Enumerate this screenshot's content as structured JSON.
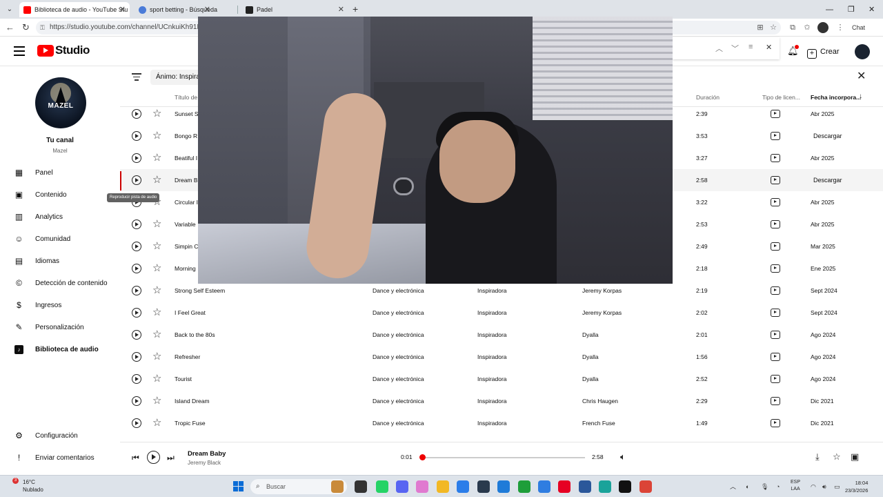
{
  "browser": {
    "tabs": [
      {
        "title": "Biblioteca de audio - YouTube Stu",
        "active": true,
        "favicon_color": "#ff0000"
      },
      {
        "title": "sport betting - Búsqueda",
        "active": false,
        "favicon_color": "#4a7bd8"
      },
      {
        "title": "Padel",
        "active": false,
        "favicon_color": "#222222"
      }
    ],
    "url": "https://studio.youtube.com/channel/UCnkuiKh91NC",
    "chat_label": "Chat"
  },
  "header": {
    "logo_text": "Studio",
    "create_label": "Crear"
  },
  "sidebar": {
    "channel_brand": "MAZEL",
    "channel_title": "Tu canal",
    "channel_name": "Mazel",
    "items": [
      {
        "label": "Panel",
        "icon": "dashboard-icon",
        "glyph": "▦"
      },
      {
        "label": "Contenido",
        "icon": "content-icon",
        "glyph": "▣"
      },
      {
        "label": "Analytics",
        "icon": "analytics-icon",
        "glyph": "▥"
      },
      {
        "label": "Comunidad",
        "icon": "community-icon",
        "glyph": "☺"
      },
      {
        "label": "Idiomas",
        "icon": "languages-icon",
        "glyph": "▤"
      },
      {
        "label": "Detección de contenido",
        "icon": "copyright-icon",
        "glyph": "©"
      },
      {
        "label": "Ingresos",
        "icon": "earn-icon",
        "glyph": "$"
      },
      {
        "label": "Personalización",
        "icon": "customization-icon",
        "glyph": "✎"
      },
      {
        "label": "Biblioteca de audio",
        "icon": "audio-library-icon",
        "glyph": "♪",
        "active": true
      }
    ],
    "footer": [
      {
        "label": "Configuración",
        "icon": "settings-icon",
        "glyph": "⚙"
      },
      {
        "label": "Enviar comentarios",
        "icon": "feedback-icon",
        "glyph": "!"
      }
    ]
  },
  "filter": {
    "chip": "Ánimo: Inspira"
  },
  "table": {
    "headers": {
      "title": "Título de",
      "duration": "Duración",
      "license": "Tipo de licen...",
      "date": "Fecha incorpora..."
    },
    "rows": [
      {
        "title": "Sunset S",
        "genre": "",
        "mood": "",
        "artist": "",
        "duration": "2:39",
        "date": "Abr 2025"
      },
      {
        "title": "Bongo R",
        "genre": "",
        "mood": "",
        "artist": "",
        "duration": "3:53",
        "download": "Descargar"
      },
      {
        "title": "Beatiful I",
        "genre": "",
        "mood": "",
        "artist": "",
        "duration": "3:27",
        "date": "Abr 2025"
      },
      {
        "title": "Dream B",
        "genre": "",
        "mood": "",
        "artist": "",
        "duration": "2:58",
        "download": "Descargar",
        "highlight": true
      },
      {
        "title": "Circular I",
        "genre": "",
        "mood": "",
        "artist": "",
        "duration": "3:22",
        "date": "Abr 2025"
      },
      {
        "title": "Variable",
        "genre": "",
        "mood": "",
        "artist": "",
        "duration": "2:53",
        "date": "Abr 2025"
      },
      {
        "title": "Simpin C",
        "genre": "",
        "mood": "",
        "artist": "",
        "duration": "2:49",
        "date": "Mar 2025"
      },
      {
        "title": "Morning",
        "genre": "",
        "mood": "",
        "artist": "",
        "duration": "2:18",
        "date": "Ene 2025"
      },
      {
        "title": "Strong Self Esteem",
        "genre": "Dance y electrónica",
        "mood": "Inspiradora",
        "artist": "Jeremy Korpas",
        "duration": "2:19",
        "date": "Sept 2024"
      },
      {
        "title": "I Feel Great",
        "genre": "Dance y electrónica",
        "mood": "Inspiradora",
        "artist": "Jeremy Korpas",
        "duration": "2:02",
        "date": "Sept 2024"
      },
      {
        "title": "Back to the 80s",
        "genre": "Dance y electrónica",
        "mood": "Inspiradora",
        "artist": "Dyalla",
        "duration": "2:01",
        "date": "Ago 2024"
      },
      {
        "title": "Refresher",
        "genre": "Dance y electrónica",
        "mood": "Inspiradora",
        "artist": "Dyalla",
        "duration": "1:56",
        "date": "Ago 2024"
      },
      {
        "title": "Tourist",
        "genre": "Dance y electrónica",
        "mood": "Inspiradora",
        "artist": "Dyalla",
        "duration": "2:52",
        "date": "Ago 2024"
      },
      {
        "title": "Island Dream",
        "genre": "Dance y electrónica",
        "mood": "Inspiradora",
        "artist": "Chris Haugen",
        "duration": "2:29",
        "date": "Dic 2021"
      },
      {
        "title": "Tropic Fuse",
        "genre": "Dance y electrónica",
        "mood": "Inspiradora",
        "artist": "French Fuse",
        "duration": "1:49",
        "date": "Dic 2021"
      }
    ],
    "tooltip": "Reproducir pista de audio"
  },
  "player": {
    "title": "Dream Baby",
    "artist": "Jeremy Black",
    "current": "0:01",
    "duration": "2:58",
    "progress_fraction": 0.006
  },
  "taskbar": {
    "weather_badge": "3",
    "temperature": "16°C",
    "condition": "Nublado",
    "search_placeholder": "Buscar",
    "lang_top": "ESP",
    "lang_bottom": "LAA",
    "time": "18:04",
    "date": "23/3/2026",
    "app_icons": [
      {
        "name": "widgets-icon",
        "color": "#c98a3a"
      },
      {
        "name": "file-explorer-icon",
        "color": "#333333"
      },
      {
        "name": "whatsapp-icon",
        "color": "#25d366"
      },
      {
        "name": "discord-icon",
        "color": "#5865f2"
      },
      {
        "name": "copilot-icon",
        "color": "#e07ad0"
      },
      {
        "name": "folder-icon",
        "color": "#f2b824"
      },
      {
        "name": "store-icon",
        "color": "#2b7de9"
      },
      {
        "name": "steam-icon",
        "color": "#2a3a4d"
      },
      {
        "name": "vscode-icon",
        "color": "#1f7bd8"
      },
      {
        "name": "xbox-icon",
        "color": "#1e9e3a"
      },
      {
        "name": "outlook-icon",
        "color": "#2f7de1"
      },
      {
        "name": "pinterest-icon",
        "color": "#e60023"
      },
      {
        "name": "word-icon",
        "color": "#2b579a"
      },
      {
        "name": "edge-icon",
        "color": "#1aa39a"
      },
      {
        "name": "capcut-icon",
        "color": "#111111"
      },
      {
        "name": "chrome-icon",
        "color": "#db4437"
      }
    ]
  }
}
